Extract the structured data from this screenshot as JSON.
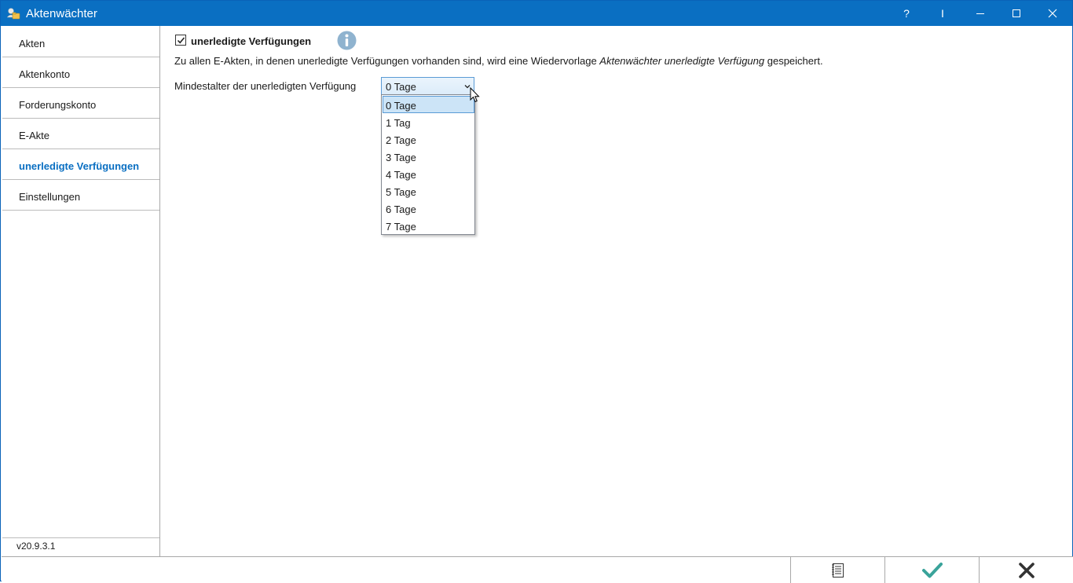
{
  "window": {
    "title": "Aktenwächter",
    "controls": {
      "help": "?",
      "pin": "I"
    }
  },
  "sidebar": {
    "items": [
      {
        "label": "Akten"
      },
      {
        "label": "Aktenkonto"
      },
      {
        "label": "Forderungskonto"
      },
      {
        "label": "E-Akte"
      },
      {
        "label": "unerledigte Verfügungen",
        "active": true
      },
      {
        "label": "Einstellungen"
      }
    ],
    "version": "v20.9.3.1"
  },
  "main": {
    "checkbox_label": "unerledigte Verfügungen",
    "checkbox_checked": true,
    "description_before": "Zu allen E-Akten, in denen unerledigte Verfügungen vorhanden sind, wird eine Wiedervorlage ",
    "description_emphasis": "Aktenwächter unerledigte Verfügung",
    "description_after": " gespeichert.",
    "min_age_label": "Mindestalter der unerledigten Verfügung",
    "min_age_selected": "0 Tage",
    "min_age_options": [
      "0 Tage",
      "1 Tag",
      "2 Tage",
      "3 Tage",
      "4 Tage",
      "5 Tage",
      "6 Tage",
      "7 Tage"
    ]
  },
  "colors": {
    "titlebar": "#0a6fc2",
    "accent": "#0a6fc2",
    "selection": "#cce4f7",
    "ok_check": "#3aa39a",
    "info_icon": "#8fb3cf"
  },
  "icons": {
    "app": "app-people-folder-icon",
    "info": "info-icon",
    "notes": "notes-list-icon",
    "ok": "checkmark-icon",
    "cancel": "close-x-icon"
  }
}
